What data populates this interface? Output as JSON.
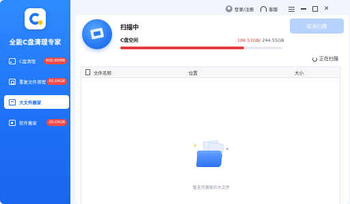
{
  "app": {
    "title": "全能C盘清理专家"
  },
  "titlebar": {
    "login_label": "登录/注册",
    "service_label": "客服"
  },
  "sidebar": {
    "items": [
      {
        "label": "C盘清理",
        "badge": "800.89MB",
        "icon": "drive-icon",
        "active": false
      },
      {
        "label": "重复文件清理",
        "badge": "65.04GB",
        "icon": "duplicate-files-icon",
        "active": false
      },
      {
        "label": "大文件搬家",
        "badge": "",
        "icon": "folder-icon",
        "active": true
      },
      {
        "label": "软件搬家",
        "badge": "20.05GB",
        "icon": "apps-icon",
        "active": false
      }
    ]
  },
  "scan": {
    "title": "扫描中",
    "drive_label": "C盘空间",
    "used": "186.53GB",
    "total": "/ 244.55GB",
    "progress_fraction": 0.763,
    "cancel_label": "取消扫描",
    "status_label": "正在扫描"
  },
  "table": {
    "columns": [
      "文件名称",
      "位置",
      "大小"
    ],
    "empty_text": "暂无可搬家的大文件"
  },
  "colors": {
    "accent": "#1e6ff5",
    "badge": "#f24949",
    "progress": "#e5393e",
    "cancel_button": "#b7d3fd"
  }
}
